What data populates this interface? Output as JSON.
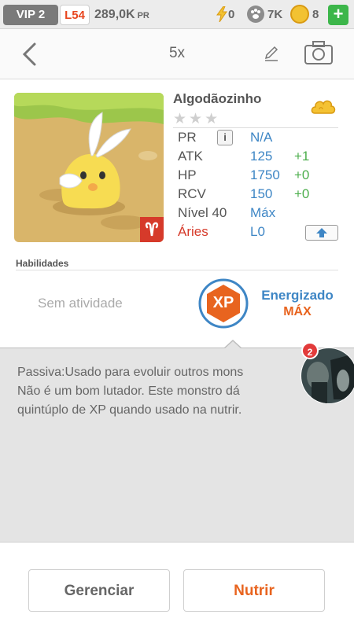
{
  "topbar": {
    "vip": "VIP 2",
    "level": "L54",
    "pr_amount": "289,0K",
    "pr_unit": "PR",
    "energy": "0",
    "paw_count": "7K",
    "coins": "8",
    "add_label": "+"
  },
  "nav": {
    "title": "5x",
    "icons": [
      "back-icon",
      "edit-icon",
      "camera-icon"
    ]
  },
  "monster": {
    "name": "Algodãozinho",
    "stars": "★★★",
    "element_icon": "cloud-element-icon",
    "stats": {
      "pr": {
        "label": "PR",
        "value": "N/A",
        "info": "i"
      },
      "atk": {
        "label": "ATK",
        "value": "125",
        "bonus": "+1"
      },
      "hp": {
        "label": "HP",
        "value": "1750",
        "bonus": "+0"
      },
      "rcv": {
        "label": "RCV",
        "value": "150",
        "bonus": "+0"
      },
      "level": {
        "label": "Nível 40",
        "value": "Máx"
      },
      "sign": {
        "label": "Áries",
        "value": "L0"
      }
    },
    "sign_icon": "aries-icon"
  },
  "abilities": {
    "title": "Habilidades",
    "none": "Sem atividade",
    "badge": "XP",
    "status": "Energizado",
    "status_level": "MÁX"
  },
  "description": {
    "line1": "Passiva:Usado para evoluir outros mons",
    "line2": "Não é um bom lutador. Este monstro dá",
    "line3": "quintúplo de XP quando usado na nutrir."
  },
  "chat": {
    "count": "2"
  },
  "buttons": {
    "manage": "Gerenciar",
    "feed": "Nutrir"
  },
  "colors": {
    "accent_orange": "#e8641f",
    "stat_blue": "#3e86c5",
    "bonus_green": "#4cae4c",
    "sign_red": "#d63a2a"
  }
}
